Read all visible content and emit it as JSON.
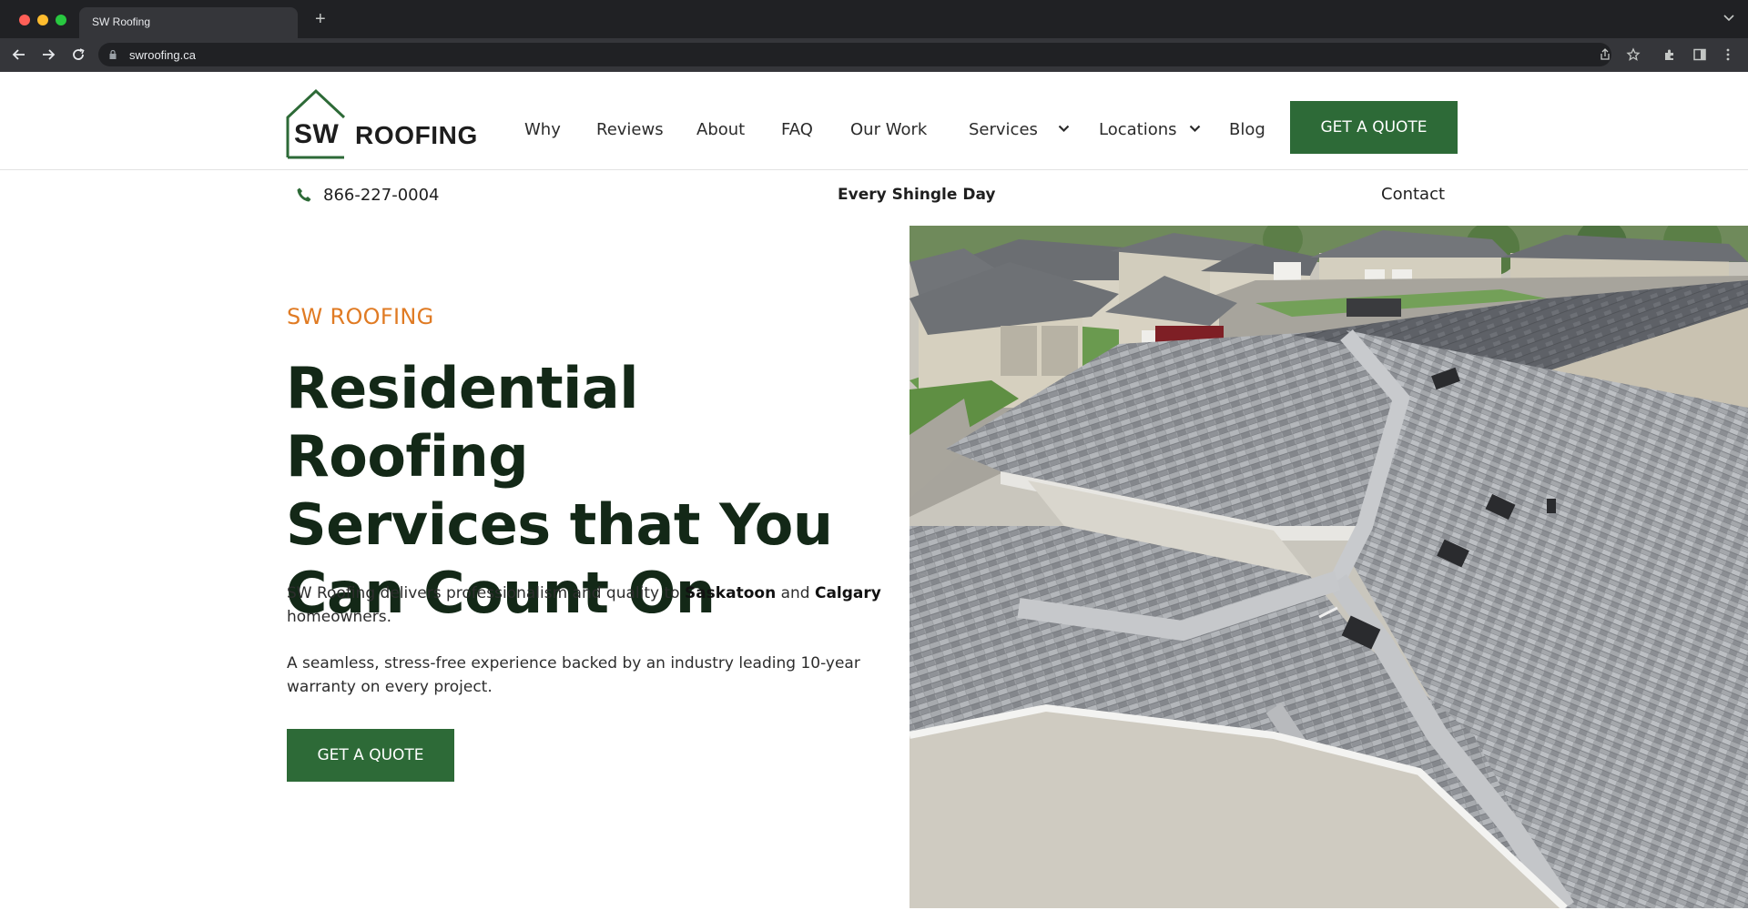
{
  "browser": {
    "tab_title": "SW Roofing",
    "new_tab_label": "+",
    "url": "swroofing.ca"
  },
  "logo": {
    "sw": "SW",
    "roofing": "ROOFING"
  },
  "nav": {
    "items": [
      "Why",
      "Reviews",
      "About",
      "FAQ",
      "Our Work",
      "Services",
      "Locations",
      "Blog"
    ],
    "cta": "GET A QUOTE"
  },
  "subbar": {
    "phone": "866-227-0004",
    "tagline": "Every Shingle Day",
    "contact": "Contact"
  },
  "hero": {
    "eyebrow": "SW ROOFING",
    "headline_1": "Residential Roofing",
    "headline_2": "Services that You",
    "headline_3": "Can Count On",
    "p1_a": "SW Roofing delivers professionalism and quality to ",
    "p1_city1": "Saskatoon",
    "p1_and": " and ",
    "p1_city2": "Calgary",
    "p1_b": " homeowners.",
    "p2": "A seamless, stress-free experience backed by an industry leading 10-year warranty on every project.",
    "cta": "GET A QUOTE"
  },
  "colors": {
    "brand_green": "#2d6a37",
    "accent_orange": "#e07b24",
    "headline": "#132817"
  },
  "icons": [
    "back-icon",
    "forward-icon",
    "reload-icon",
    "lock-icon",
    "share-icon",
    "bookmark-star-icon",
    "extensions-icon",
    "sidebar-icon",
    "kebab-menu-icon",
    "phone-icon",
    "chevron-down-icon"
  ]
}
